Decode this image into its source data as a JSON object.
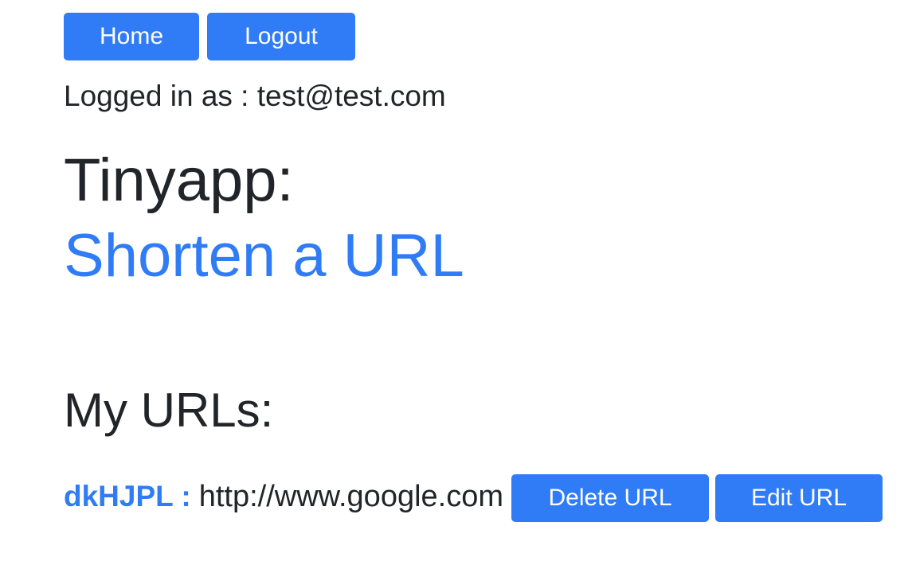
{
  "nav": {
    "home_label": "Home",
    "logout_label": "Logout"
  },
  "user": {
    "logged_in_text": "Logged in as : test@test.com"
  },
  "header": {
    "title": "Tinyapp:",
    "shorten_link": "Shorten a URL"
  },
  "urls": {
    "heading": "My URLs:",
    "items": [
      {
        "short": "dkHJPL :",
        "long": "http://www.google.com",
        "delete_label": "Delete URL",
        "edit_label": "Edit URL"
      }
    ]
  },
  "colors": {
    "accent": "#2f7cf6",
    "text": "#212529",
    "background": "#ffffff"
  }
}
